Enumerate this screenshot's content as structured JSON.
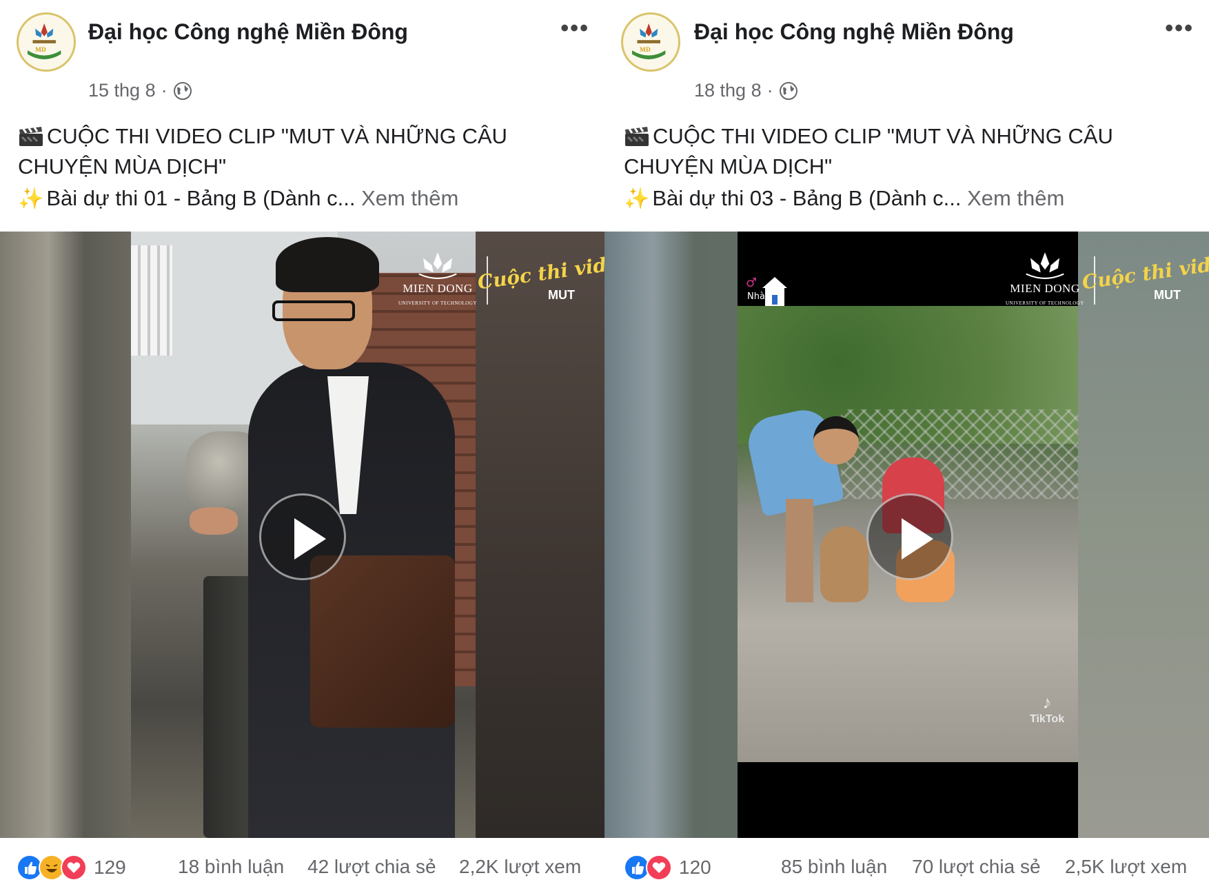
{
  "posts": [
    {
      "page_name": "Đại học Công nghệ Miền Đông",
      "date": "15 thg 8",
      "separator": "·",
      "caption_line": "CUỘC THI VIDEO CLIP \"MUT VÀ NHỮNG CÂU CHUYỆN MÙA DỊCH\"",
      "entry": "Bài dự thi 01 - Bảng B (Dành c...",
      "see_more": "Xem thêm",
      "reaction_count": "129",
      "comments": "18 bình luận",
      "shares": "42 lượt chia sẻ",
      "views": "2,2K lượt xem",
      "reactions": [
        "like-icon",
        "haha-icon",
        "love-icon"
      ]
    },
    {
      "page_name": "Đại học Công nghệ Miền Đông",
      "date": "18 thg 8",
      "separator": "·",
      "caption_line": "CUỘC THI VIDEO CLIP \"MUT VÀ NHỮNG CÂU CHUYỆN MÙA DỊCH\"",
      "entry": "Bài dự thi 03 - Bảng B (Dành c...",
      "see_more": "Xem thêm",
      "reaction_count": "120",
      "comments": "85 bình luận",
      "shares": "70 lượt chia sẻ",
      "views": "2,5K lượt xem",
      "reactions": [
        "like-icon",
        "love-icon"
      ]
    }
  ],
  "video_overlay": {
    "school_mark": "MIEN DONG",
    "school_sub": "UNIVERSITY OF TECHNOLOGY",
    "script_title": "Cuộc thi video",
    "mut": "MUT",
    "tiktok_label": "TikTok"
  },
  "colors": {
    "like_blue": "#1877f2",
    "love_red": "#f33e58",
    "haha_yellow": "#f7b125",
    "secondary_text": "#65676b",
    "brand_gold": "#f3d34a"
  }
}
